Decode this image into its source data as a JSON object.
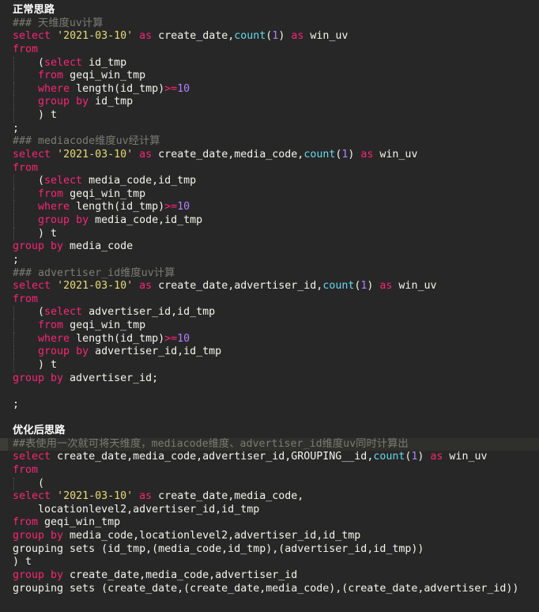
{
  "colors": {
    "background": "#272727",
    "keyword": "#f92672",
    "string": "#e6db74",
    "function": "#66d9ef",
    "number": "#ae81ff",
    "comment": "#7c7c74",
    "text": "#f4f4ee"
  },
  "lines": [
    [
      [
        "h",
        "正常思路"
      ]
    ],
    [
      [
        "c",
        "### 天维度uv计算"
      ]
    ],
    [
      [
        "k",
        "select"
      ],
      [
        "t",
        " "
      ],
      [
        "s",
        "'2021-03-10'"
      ],
      [
        "t",
        " "
      ],
      [
        "k",
        "as"
      ],
      [
        "t",
        " create_date,"
      ],
      [
        "f",
        "count"
      ],
      [
        "t",
        "("
      ],
      [
        "n",
        "1"
      ],
      [
        "t",
        ") "
      ],
      [
        "k",
        "as"
      ],
      [
        "t",
        " win_uv"
      ]
    ],
    [
      [
        "k",
        "from"
      ]
    ],
    [
      [
        "t",
        "    ("
      ],
      [
        "k",
        "select"
      ],
      [
        "t",
        " id_tmp"
      ]
    ],
    [
      [
        "t",
        "    "
      ],
      [
        "k",
        "from"
      ],
      [
        "t",
        " geqi_win_tmp"
      ]
    ],
    [
      [
        "t",
        "    "
      ],
      [
        "k",
        "where"
      ],
      [
        "t",
        " length(id_tmp)"
      ],
      [
        "k",
        ">="
      ],
      [
        "n",
        "10"
      ]
    ],
    [
      [
        "t",
        "    "
      ],
      [
        "k",
        "group by"
      ],
      [
        "t",
        " id_tmp"
      ]
    ],
    [
      [
        "t",
        "    ) t"
      ]
    ],
    [
      [
        "t",
        ";"
      ]
    ],
    [
      [
        "c",
        "### mediacode维度uv经计算"
      ]
    ],
    [
      [
        "k",
        "select"
      ],
      [
        "t",
        " "
      ],
      [
        "s",
        "'2021-03-10'"
      ],
      [
        "t",
        " "
      ],
      [
        "k",
        "as"
      ],
      [
        "t",
        " create_date,media_code,"
      ],
      [
        "f",
        "count"
      ],
      [
        "t",
        "("
      ],
      [
        "n",
        "1"
      ],
      [
        "t",
        ") "
      ],
      [
        "k",
        "as"
      ],
      [
        "t",
        " win_uv"
      ]
    ],
    [
      [
        "k",
        "from"
      ]
    ],
    [
      [
        "t",
        "    ("
      ],
      [
        "k",
        "select"
      ],
      [
        "t",
        " media_code,id_tmp"
      ]
    ],
    [
      [
        "t",
        "    "
      ],
      [
        "k",
        "from"
      ],
      [
        "t",
        " geqi_win_tmp"
      ]
    ],
    [
      [
        "t",
        "    "
      ],
      [
        "k",
        "where"
      ],
      [
        "t",
        " length(id_tmp)"
      ],
      [
        "k",
        ">="
      ],
      [
        "n",
        "10"
      ]
    ],
    [
      [
        "t",
        "    "
      ],
      [
        "k",
        "group by"
      ],
      [
        "t",
        " media_code,id_tmp"
      ]
    ],
    [
      [
        "t",
        "    ) t"
      ]
    ],
    [
      [
        "k",
        "group by"
      ],
      [
        "t",
        " media_code"
      ]
    ],
    [
      [
        "t",
        ";"
      ]
    ],
    [
      [
        "c",
        "### advertiser_id维度uv计算"
      ]
    ],
    [
      [
        "k",
        "select"
      ],
      [
        "t",
        " "
      ],
      [
        "s",
        "'2021-03-10'"
      ],
      [
        "t",
        " "
      ],
      [
        "k",
        "as"
      ],
      [
        "t",
        " create_date,advertiser_id,"
      ],
      [
        "f",
        "count"
      ],
      [
        "t",
        "("
      ],
      [
        "n",
        "1"
      ],
      [
        "t",
        ") "
      ],
      [
        "k",
        "as"
      ],
      [
        "t",
        " win_uv"
      ]
    ],
    [
      [
        "k",
        "from"
      ]
    ],
    [
      [
        "t",
        "    ("
      ],
      [
        "k",
        "select"
      ],
      [
        "t",
        " advertiser_id,id_tmp"
      ]
    ],
    [
      [
        "t",
        "    "
      ],
      [
        "k",
        "from"
      ],
      [
        "t",
        " geqi_win_tmp"
      ]
    ],
    [
      [
        "t",
        "    "
      ],
      [
        "k",
        "where"
      ],
      [
        "t",
        " length(id_tmp)"
      ],
      [
        "k",
        ">="
      ],
      [
        "n",
        "10"
      ]
    ],
    [
      [
        "t",
        "    "
      ],
      [
        "k",
        "group by"
      ],
      [
        "t",
        " advertiser_id,id_tmp"
      ]
    ],
    [
      [
        "t",
        "    ) t"
      ]
    ],
    [
      [
        "k",
        "group by"
      ],
      [
        "t",
        " advertiser_id;"
      ]
    ],
    [],
    [
      [
        "t",
        ";"
      ]
    ],
    [],
    [
      [
        "h",
        "优化后思路"
      ]
    ],
    [
      [
        "c",
        "##表使用一次就可将天维度，mediacode维度、advertiser_id维度uv同时计算出"
      ]
    ],
    [
      [
        "k",
        "select"
      ],
      [
        "t",
        " create_date,media_code,advertiser_id,GROUPING__id,"
      ],
      [
        "f",
        "count"
      ],
      [
        "t",
        "("
      ],
      [
        "n",
        "1"
      ],
      [
        "t",
        ") "
      ],
      [
        "k",
        "as"
      ],
      [
        "t",
        " win_uv"
      ]
    ],
    [
      [
        "k",
        "from"
      ]
    ],
    [
      [
        "t",
        "    ("
      ]
    ],
    [
      [
        "k",
        "select"
      ],
      [
        "t",
        " "
      ],
      [
        "s",
        "'2021-03-10'"
      ],
      [
        "t",
        " "
      ],
      [
        "k",
        "as"
      ],
      [
        "t",
        " create_date,media_code,"
      ]
    ],
    [
      [
        "t",
        "    locationlevel2,advertiser_id,id_tmp"
      ]
    ],
    [
      [
        "k",
        "from"
      ],
      [
        "t",
        " geqi_win_tmp"
      ]
    ],
    [
      [
        "k",
        "group by"
      ],
      [
        "t",
        " media_code,locationlevel2,advertiser_id,id_tmp"
      ]
    ],
    [
      [
        "t",
        "grouping sets (id_tmp,(media_code,id_tmp),(advertiser_id,id_tmp))"
      ]
    ],
    [
      [
        "t",
        ") t"
      ]
    ],
    [
      [
        "k",
        "group by"
      ],
      [
        "t",
        " create_date,media_code,advertiser_id"
      ]
    ],
    [
      [
        "t",
        "grouping sets (create_date,(create_date,media_code),(create_date,advertiser_id))"
      ]
    ]
  ]
}
